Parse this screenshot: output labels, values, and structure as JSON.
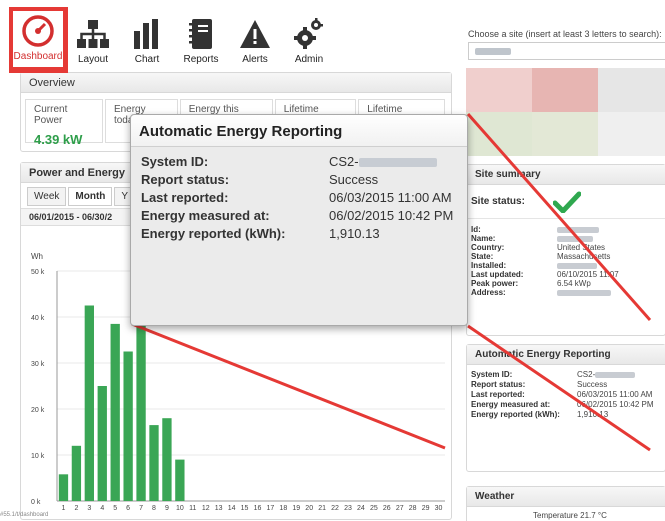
{
  "nav": [
    {
      "label": "Dashboard",
      "icon": "speedometer-icon",
      "active": true
    },
    {
      "label": "Layout",
      "icon": "hierarchy-icon"
    },
    {
      "label": "Chart",
      "icon": "bar-chart-icon"
    },
    {
      "label": "Reports",
      "icon": "notebook-icon"
    },
    {
      "label": "Alerts",
      "icon": "warning-icon"
    },
    {
      "label": "Admin",
      "icon": "gears-icon"
    }
  ],
  "overview": {
    "title": "Overview",
    "cells": [
      {
        "label": "Current Power",
        "value": "4.39 kW"
      },
      {
        "label": "Energy today",
        "value": ""
      },
      {
        "label": "Energy this month",
        "value": ""
      },
      {
        "label": "Lifetime energy",
        "value": ""
      },
      {
        "label": "Lifetime revenue",
        "value": ""
      }
    ]
  },
  "power_energy": {
    "title": "Power and Energy",
    "tabs": [
      "Week",
      "Month",
      "Y"
    ],
    "active_tab": "Month",
    "range": "06/01/2015 - 06/30/2"
  },
  "chart_data": {
    "type": "bar",
    "ylabel": "Wh",
    "ylim": [
      0,
      50000
    ],
    "yticks": [
      "0 k",
      "10 k",
      "20 k",
      "30 k",
      "40 k",
      "50 k"
    ],
    "categories": [
      "1",
      "2",
      "3",
      "4",
      "5",
      "6",
      "7",
      "8",
      "9",
      "10",
      "11",
      "12",
      "13",
      "14",
      "15",
      "16",
      "17",
      "18",
      "19",
      "20",
      "21",
      "22",
      "23",
      "24",
      "25",
      "26",
      "27",
      "28",
      "29",
      "30"
    ],
    "values": [
      5800,
      12000,
      42500,
      25000,
      38500,
      32500,
      38500,
      16500,
      18000,
      9000,
      0,
      0,
      0,
      0,
      0,
      0,
      0,
      0,
      0,
      0,
      0,
      0,
      0,
      0,
      0,
      0,
      0,
      0,
      0,
      0
    ],
    "bar_color": "#3aa655"
  },
  "site_search": {
    "label": "Choose a site (insert at least 3 letters to search):"
  },
  "site_summary": {
    "title": "Site summary",
    "status_label": "Site status:",
    "rows": [
      {
        "k": "Id:",
        "v": ""
      },
      {
        "k": "Name:",
        "v": ""
      },
      {
        "k": "Country:",
        "v": "United States"
      },
      {
        "k": "State:",
        "v": "Massachusetts"
      },
      {
        "k": "Installed:",
        "v": ""
      },
      {
        "k": "Last updated:",
        "v": "06/10/2015 11:07"
      },
      {
        "k": "Peak power:",
        "v": "6.54 kWp"
      },
      {
        "k": "Address:",
        "v": ""
      }
    ]
  },
  "aer_small": {
    "title": "Automatic Energy Reporting",
    "rows": [
      {
        "k": "System ID:",
        "v": "CS2-"
      },
      {
        "k": "Report status:",
        "v": "Success"
      },
      {
        "k": "Last reported:",
        "v": "06/03/2015 11:00 AM"
      },
      {
        "k": "Energy measured at:",
        "v": "06/02/2015 10:42 PM"
      },
      {
        "k": "Energy reported (kWh):",
        "v": "1,910.13"
      }
    ]
  },
  "weather": {
    "title": "Weather",
    "temperature": "Temperature 21.7 °C"
  },
  "popup": {
    "title": "Automatic Energy Reporting",
    "rows": [
      {
        "k": "System ID:",
        "v": "CS2-"
      },
      {
        "k": "Report status:",
        "v": "Success"
      },
      {
        "k": "Last reported:",
        "v": "06/03/2015 11:00 AM"
      },
      {
        "k": "Energy measured at:",
        "v": "06/02/2015 10:42 PM"
      },
      {
        "k": "Energy reported (kWh):",
        "v": "1,910.13"
      }
    ]
  },
  "colors": {
    "highlight": "#e53935",
    "value_green": "#2e9e4a",
    "check_green": "#2fa84f"
  },
  "footer_url": "#55.1/t/dashboard"
}
